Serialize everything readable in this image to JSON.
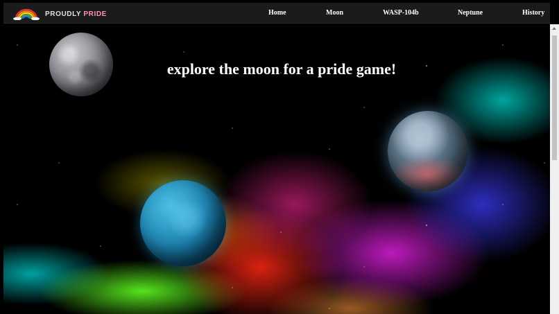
{
  "nav": {
    "brand_main": "PROUDLY",
    "brand_accent": "PRIDE",
    "logo_icon": "rainbow-icon",
    "links": [
      {
        "label": "Home"
      },
      {
        "label": "Moon"
      },
      {
        "label": "WASP-104b"
      },
      {
        "label": "Neptune"
      },
      {
        "label": "History"
      }
    ]
  },
  "hero": {
    "headline": "explore the moon for a pride game!",
    "planets": [
      "mercury-planet",
      "neptune-planet",
      "wasp-104b-planet"
    ]
  },
  "colors": {
    "navbar_bg": "#1b1b1b",
    "brand_accent": "#ff8fb8",
    "text": "#ffffff"
  }
}
